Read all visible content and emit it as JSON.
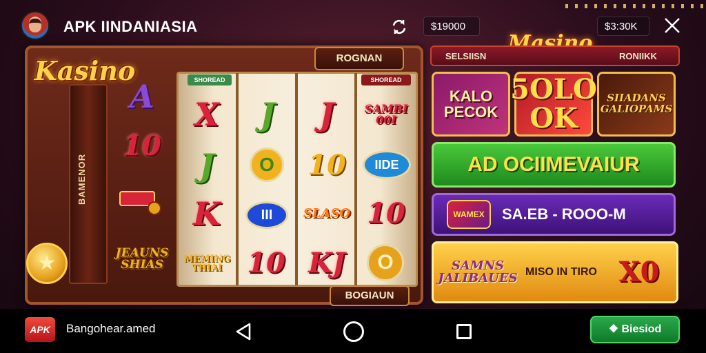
{
  "header": {
    "app_title": "APK IINDANIASIA",
    "balance_left": "$19000",
    "balance_right": "$3:30K",
    "icons": {
      "avatar": "user-avatar",
      "refresh": "refresh-icon",
      "close": "close-icon"
    }
  },
  "slot": {
    "logo_text": "Kasino",
    "top_button": "ROGNAN",
    "pillar_text": "BAMENOR",
    "bottom_button": "BOGIAUN",
    "left_column": [
      "A",
      "10",
      "",
      "JEAUNS SHIAS"
    ],
    "reel_labels": [
      "SHOREAD",
      "",
      "",
      "SHOREAD"
    ],
    "reels": [
      [
        "X",
        "J",
        "K",
        "MEMING THIAI"
      ],
      [
        "J",
        "O",
        "III",
        "10"
      ],
      [
        "J",
        "10",
        "SLASO",
        "KJ"
      ],
      [
        "SAMBI 00I",
        "IIDE",
        "10",
        "O"
      ]
    ]
  },
  "side_panel": {
    "logo_text": "Masino",
    "tabs": [
      "SELSIISN",
      "RONIIKK"
    ],
    "cards": [
      "KALO PECOK",
      "5OLO OK",
      "SIIADANS GALIOPAMS"
    ],
    "green_button": "AD OCIIMEVAIUR",
    "purple_icon_text": "WAMEX",
    "purple_text": "SA.EB - ROOO-M",
    "gold_left": "SAMNS JALIBAUES",
    "gold_mid": "MISO IN TIRO",
    "gold_right": "X0"
  },
  "navbar": {
    "apk_icon": "APK",
    "label": "Bangohear.amed",
    "action_button": "❖ Biesiod",
    "icons": [
      "back-icon",
      "home-icon",
      "recent-apps-icon"
    ]
  },
  "colors": {
    "background": "#2a0d1c",
    "gold": "#ffd24a",
    "green_button": "#2aa84a",
    "purple_bar": "#6a2ab8",
    "red_tab": "#8a1a2a"
  }
}
